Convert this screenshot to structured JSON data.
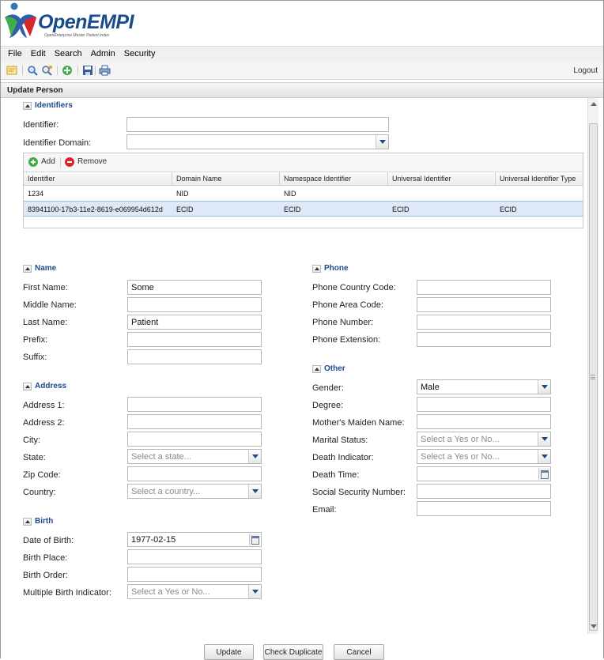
{
  "app": {
    "logo_text_main": "Open",
    "logo_text_accent": "EMPI",
    "logo_subtitle": "OpenEnterprise Master Patient Index"
  },
  "menu": [
    "File",
    "Edit",
    "Search",
    "Admin",
    "Security"
  ],
  "toolbar": {
    "icons": [
      "basic-search-icon",
      "search-icon",
      "advanced-search-icon",
      "add-person-icon",
      "save-icon",
      "print-icon"
    ],
    "logout": "Logout"
  },
  "panel": {
    "title": "Update Person"
  },
  "identifiers": {
    "section_title": "Identifiers",
    "identifier_label": "Identifier:",
    "identifier_value": "",
    "domain_label": "Identifier Domain:",
    "domain_value": "",
    "add_label": "Add",
    "remove_label": "Remove",
    "columns": [
      "Identifier",
      "Domain Name",
      "Namespace Identifier",
      "Universal Identifier",
      "Universal Identifier Type"
    ],
    "rows": [
      [
        "1234",
        "NID",
        "NID",
        "",
        ""
      ],
      [
        "83941100-17b3-11e2-8619-e069954d612d",
        "ECID",
        "ECID",
        "ECID",
        "ECID"
      ]
    ]
  },
  "name": {
    "section_title": "Name",
    "first_label": "First Name:",
    "first_value": "Some",
    "middle_label": "Middle Name:",
    "middle_value": "",
    "last_label": "Last Name:",
    "last_value": "Patient",
    "prefix_label": "Prefix:",
    "prefix_value": "",
    "suffix_label": "Suffix:",
    "suffix_value": ""
  },
  "address": {
    "section_title": "Address",
    "address1_label": "Address 1:",
    "address2_label": "Address 2:",
    "city_label": "City:",
    "state_label": "State:",
    "state_placeholder": "Select a state...",
    "zip_label": "Zip Code:",
    "country_label": "Country:",
    "country_placeholder": "Select a country..."
  },
  "birth": {
    "section_title": "Birth",
    "dob_label": "Date of Birth:",
    "dob_value": "1977-02-15",
    "place_label": "Birth Place:",
    "order_label": "Birth Order:",
    "multiple_label": "Multiple Birth Indicator:",
    "multiple_placeholder": "Select a Yes or No..."
  },
  "phone": {
    "section_title": "Phone",
    "country_code_label": "Phone Country Code:",
    "area_code_label": "Phone Area Code:",
    "number_label": "Phone Number:",
    "extension_label": "Phone Extension:"
  },
  "other": {
    "section_title": "Other",
    "gender_label": "Gender:",
    "gender_value": "Male",
    "degree_label": "Degree:",
    "maiden_label": "Mother's Maiden Name:",
    "marital_label": "Marital Status:",
    "marital_placeholder": "Select a Yes or No...",
    "death_ind_label": "Death Indicator:",
    "death_ind_placeholder": "Select a Yes or No...",
    "death_time_label": "Death Time:",
    "ssn_label": "Social Security Number:",
    "email_label": "Email:"
  },
  "buttons": {
    "update": "Update",
    "check_duplicate": "Check Duplicate",
    "cancel": "Cancel"
  }
}
